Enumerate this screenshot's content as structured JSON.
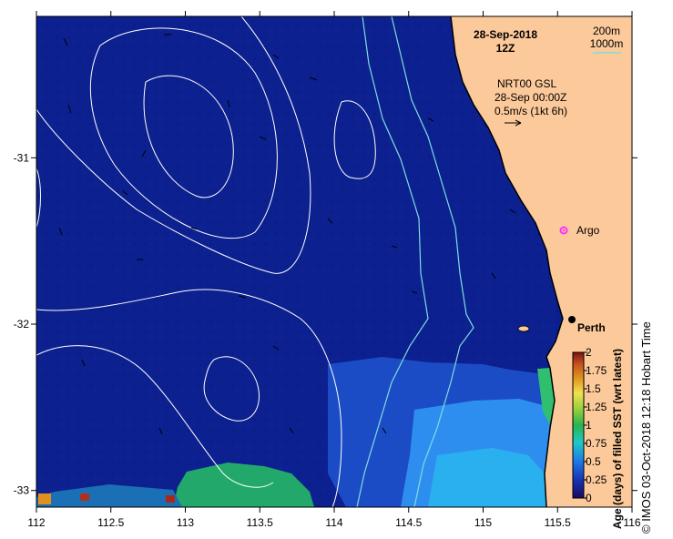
{
  "header": {
    "date": "28-Sep-2018",
    "time": "12Z"
  },
  "bathymetry_legend": {
    "contour_1": "200m",
    "contour_2": "1000m",
    "color": "#7fdede"
  },
  "current_legend": {
    "line1": "NRT00 GSL",
    "line2": "28-Sep 00:00Z",
    "line3": "0.5m/s (1kt 6h)"
  },
  "places": [
    {
      "name": "Argo",
      "kind": "argo-float",
      "lon": 115.82,
      "lat": -31.41,
      "color": "#ff33ff"
    },
    {
      "name": "Perth",
      "kind": "city",
      "lon": 115.85,
      "lat": -31.95,
      "color": "#000000"
    }
  ],
  "axes": {
    "x_ticks": [
      "112",
      "112.5",
      "113",
      "113.5",
      "114",
      "114.5",
      "115",
      "115.5",
      "116"
    ],
    "y_ticks": [
      "-31",
      "-32",
      "-33"
    ],
    "lon_range": [
      112,
      116
    ],
    "lat_range": [
      -33.1,
      -30.15
    ]
  },
  "colorbar": {
    "title": "Age (days) of filled SST (wrt latest)",
    "ticks": [
      "0",
      "0.25",
      "0.5",
      "0.75",
      "1",
      "1.25",
      "1.5",
      "1.75",
      "2"
    ],
    "range": [
      0,
      2
    ]
  },
  "credit": "© IMOS 03-Oct-2018 12:18 Hobart Time",
  "colors": {
    "ocean": "#0b1e8c",
    "land": "#fcc99a",
    "coast": "#000000",
    "contour": "#ffffff"
  }
}
